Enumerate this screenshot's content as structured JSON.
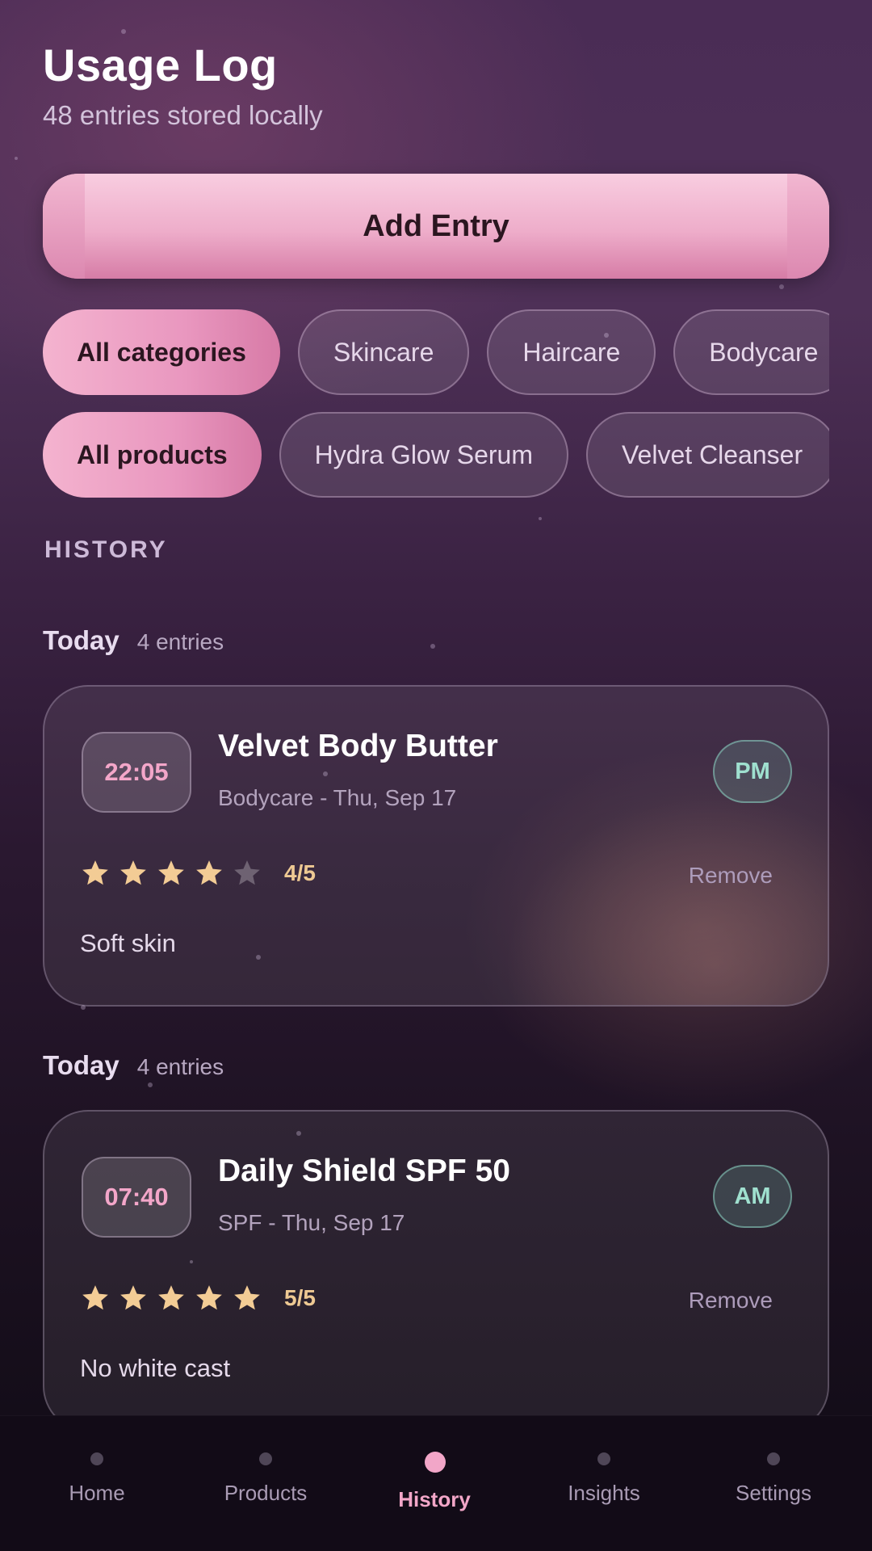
{
  "header": {
    "title": "Usage Log",
    "subtitle": "48 entries stored locally"
  },
  "add_button": {
    "label": "Add Entry"
  },
  "category_filters": [
    {
      "label": "All categories",
      "active": true
    },
    {
      "label": "Skincare",
      "active": false
    },
    {
      "label": "Haircare",
      "active": false
    },
    {
      "label": "Bodycare",
      "active": false
    }
  ],
  "product_filters": [
    {
      "label": "All products",
      "active": true
    },
    {
      "label": "Hydra Glow Serum",
      "active": false
    },
    {
      "label": "Velvet Cleanser",
      "active": false
    }
  ],
  "section_label": "HISTORY",
  "groups": [
    {
      "title": "Today",
      "count": "4 entries",
      "entry": {
        "time": "22:05",
        "product": "Velvet Body Butter",
        "meta": "Bodycare - Thu, Sep 17",
        "period": "PM",
        "rating": 4,
        "rating_max": 5,
        "rating_label": "4/5",
        "remove_label": "Remove",
        "note": "Soft skin"
      }
    },
    {
      "title": "Today",
      "count": "4 entries",
      "entry": {
        "time": "07:40",
        "product": "Daily Shield SPF 50",
        "meta": "SPF - Thu, Sep 17",
        "period": "AM",
        "rating": 5,
        "rating_max": 5,
        "rating_label": "5/5",
        "remove_label": "Remove",
        "note": "No white cast"
      }
    }
  ],
  "nav": {
    "items": [
      {
        "label": "Home",
        "icon": "dot-icon",
        "active": false
      },
      {
        "label": "Products",
        "icon": "dot-icon",
        "active": false
      },
      {
        "label": "History",
        "icon": "dot-icon",
        "active": true
      },
      {
        "label": "Insights",
        "icon": "dot-icon",
        "active": false
      },
      {
        "label": "Settings",
        "icon": "dot-icon",
        "active": false
      }
    ]
  },
  "colors": {
    "accent": "#f2a6c8",
    "star_filled": "#f3cc95",
    "star_empty": "#6e6272",
    "period_text": "#9fe0cf"
  }
}
